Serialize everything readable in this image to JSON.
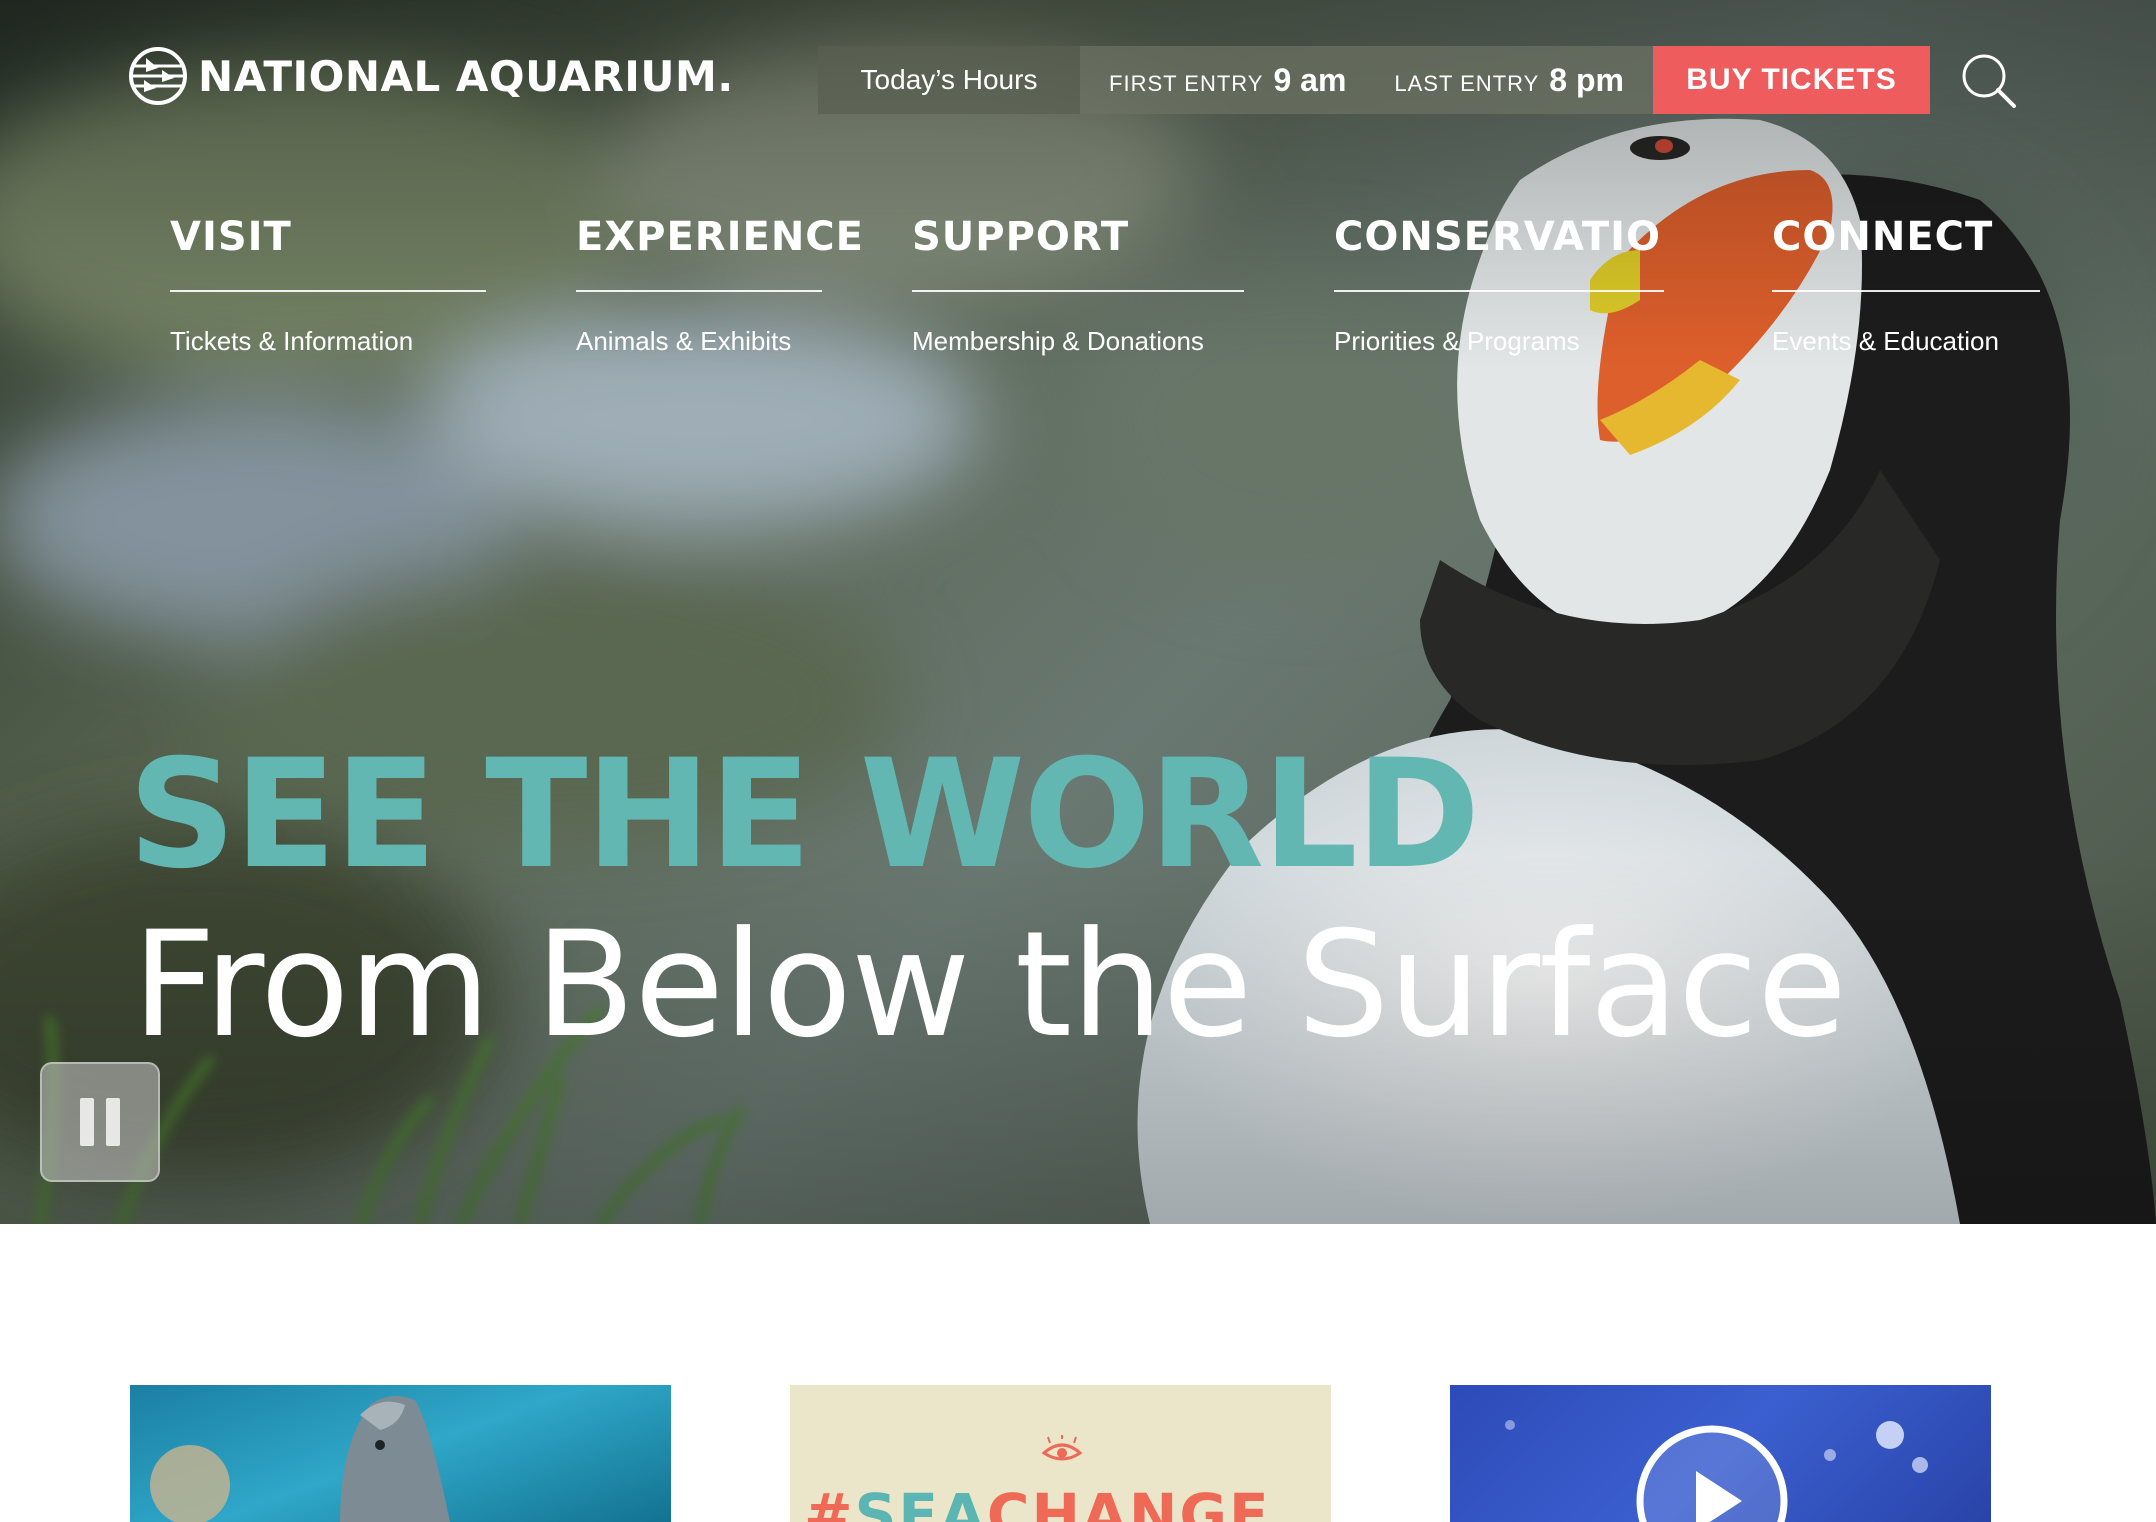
{
  "brand": {
    "name": "NATIONAL AQUARIUM.",
    "logo_icon": "globe-fish-logo-icon"
  },
  "hours": {
    "label": "Today’s Hours",
    "first_entry_label": "FIRST ENTRY",
    "first_entry_time": "9 am",
    "last_entry_label": "LAST ENTRY",
    "last_entry_time": "8 pm"
  },
  "header": {
    "buy_tickets_label": "BUY TICKETS",
    "search_icon": "search-icon"
  },
  "nav": [
    {
      "label": "VISIT",
      "sub": "Tickets & Information"
    },
    {
      "label": "EXPERIENCE",
      "sub": "Animals & Exhibits"
    },
    {
      "label": "SUPPORT",
      "sub": "Membership & Donations"
    },
    {
      "label": "CONSERVATION",
      "sub": "Priorities & Programs"
    },
    {
      "label": "CONNECT",
      "sub": "Events & Education"
    }
  ],
  "hero": {
    "headline_top": "SEE THE WORLD",
    "headline_bottom": "From Below the Surface",
    "pause_icon": "pause-icon"
  },
  "cards": {
    "seachange": {
      "hash": "#",
      "sea": "SEA",
      "change": "CHANGE"
    },
    "video_icon": "play-icon"
  },
  "colors": {
    "accent_teal": "#62b7b2",
    "buy_tickets_red": "#ee5c5e",
    "seachange_coral": "#ee6a57"
  }
}
